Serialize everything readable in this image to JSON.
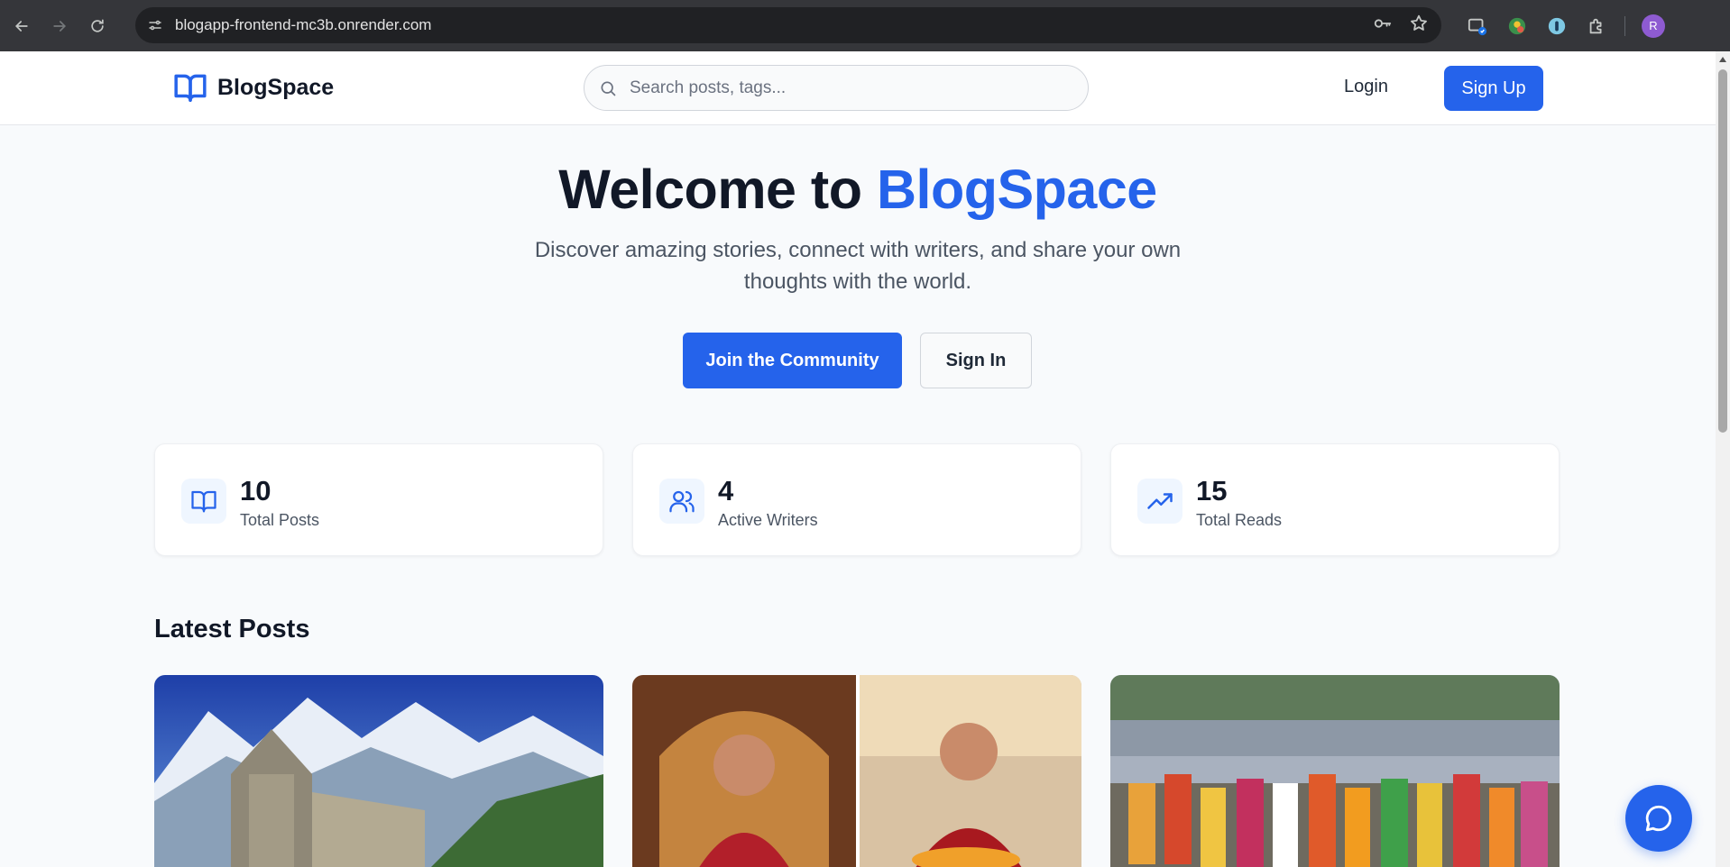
{
  "browser": {
    "url": "blogapp-frontend-mc3b.onrender.com",
    "profile_initial": "R"
  },
  "header": {
    "brand": "BlogSpace",
    "search_placeholder": "Search posts, tags...",
    "login_label": "Login",
    "signup_label": "Sign Up"
  },
  "hero": {
    "title_prefix": "Welcome to ",
    "title_accent": "BlogSpace",
    "subtitle": "Discover amazing stories, connect with writers, and share your own thoughts with the world.",
    "primary_cta": "Join the Community",
    "secondary_cta": "Sign In"
  },
  "stats": [
    {
      "value": "10",
      "label": "Total Posts",
      "icon": "book-open-icon"
    },
    {
      "value": "4",
      "label": "Active Writers",
      "icon": "users-icon"
    },
    {
      "value": "15",
      "label": "Total Reads",
      "icon": "trending-up-icon"
    }
  ],
  "latest": {
    "title": "Latest Posts"
  },
  "colors": {
    "brand": "#2563eb",
    "page_bg": "#f8fafc",
    "heading": "#111827",
    "muted": "#4b5563"
  }
}
